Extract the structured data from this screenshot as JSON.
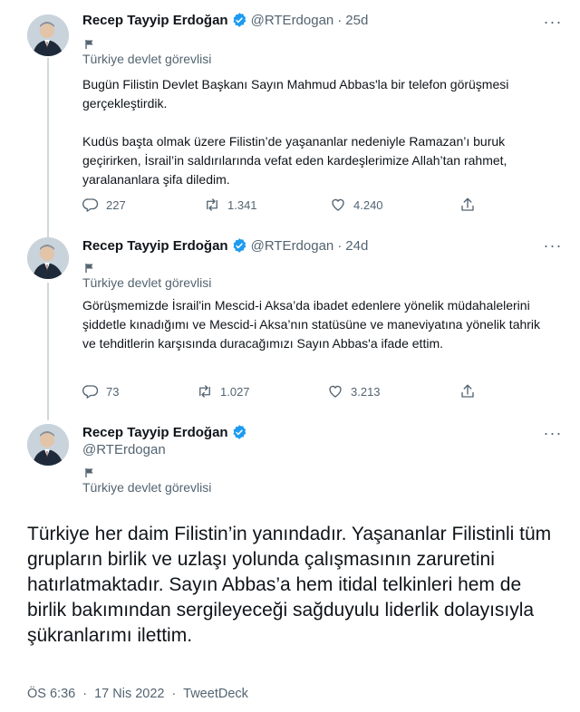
{
  "colors": {
    "accent": "#1d9bf0",
    "text": "#0f1419",
    "muted": "#536471",
    "line": "#cfd9de"
  },
  "tweets": [
    {
      "display_name": "Recep Tayyip Erdoğan",
      "handle": "@RTErdogan",
      "dot": "·",
      "age": "25d",
      "label": "Türkiye devlet görevlisi",
      "paragraphs": [
        "Bugün Filistin Devlet Başkanı Sayın Mahmud Abbas'la bir telefon görüşmesi gerçekleştirdik.",
        "Kudüs başta olmak üzere Filistin’de yaşananlar nedeniyle Ramazan’ı buruk geçirirken, İsrail’in saldırılarında vefat eden kardeşlerimize Allah’tan rahmet, yaralananlara şifa diledim."
      ],
      "replies": "227",
      "retweets": "1.341",
      "likes": "4.240"
    },
    {
      "display_name": "Recep Tayyip Erdoğan",
      "handle": "@RTErdogan",
      "dot": "·",
      "age": "24d",
      "label": "Türkiye devlet görevlisi",
      "paragraphs": [
        "Görüşmemizde İsrail'in Mescid-i Aksa’da ibadet edenlere yönelik müdahalelerini şiddetle kınadığımı ve Mescid-i Aksa’nın statüsüne ve maneviyatına yönelik tahrik ve tehditlerin karşısında duracağımızı Sayın Abbas'a ifade ettim."
      ],
      "replies": "73",
      "retweets": "1.027",
      "likes": "3.213"
    },
    {
      "display_name": "Recep Tayyip Erdoğan",
      "handle": "@RTErdogan",
      "label": "Türkiye devlet görevlisi",
      "text": "Türkiye her daim Filistin’in yanındadır. Yaşananlar Filistinli tüm grupların birlik ve uzlaşı yolunda çalışmasının zaruretini hatırlatmaktadır. Sayın Abbas’a hem itidal telkinleri hem de birlik bakımından sergileyeceği sağduyulu liderlik dolayısıyla şükranlarımı ilettim.",
      "time": "ÖS 6:36",
      "dot": "·",
      "date": "17 Nis 2022",
      "source": "TweetDeck"
    }
  ],
  "icons": {
    "more": "more-horizontal-icon",
    "verified": "verified-badge-icon",
    "flag": "flag-icon",
    "reply": "reply-icon",
    "retweet": "retweet-icon",
    "like": "like-icon",
    "share": "share-icon"
  },
  "more_glyph": "···"
}
